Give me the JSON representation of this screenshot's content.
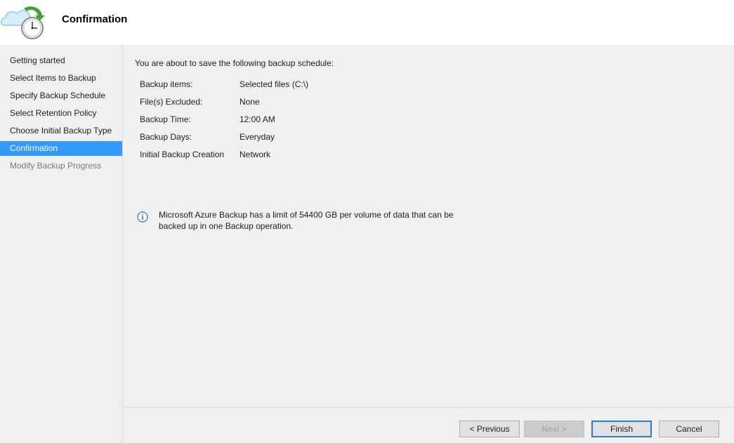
{
  "header": {
    "title": "Confirmation",
    "icon": "backup-schedule-icon"
  },
  "sidebar": {
    "items": [
      {
        "label": "Getting started",
        "state": "normal"
      },
      {
        "label": "Select Items to Backup",
        "state": "normal"
      },
      {
        "label": "Specify Backup Schedule",
        "state": "normal"
      },
      {
        "label": "Select Retention Policy",
        "state": "normal"
      },
      {
        "label": "Choose Initial Backup Type",
        "state": "normal"
      },
      {
        "label": "Confirmation",
        "state": "active"
      },
      {
        "label": "Modify Backup Progress",
        "state": "disabled"
      }
    ]
  },
  "main": {
    "intro": "You are about to save the following backup schedule:",
    "summary": [
      {
        "label": "Backup items:",
        "value": "Selected files (C:\\)"
      },
      {
        "label": "File(s) Excluded:",
        "value": "None"
      },
      {
        "label": "Backup Time:",
        "value": "12:00 AM"
      },
      {
        "label": "Backup Days:",
        "value": "Everyday"
      },
      {
        "label": "Initial Backup Creation",
        "value": "Network"
      }
    ],
    "info_line1": "Microsoft Azure Backup has a limit of 54400 GB per volume of data that can be",
    "info_line2": "backed up in one Backup operation."
  },
  "footer": {
    "previous": "< Previous",
    "next": "Next >",
    "finish": "Finish",
    "cancel": "Cancel"
  },
  "colors": {
    "accent": "#3399ff",
    "background": "#f0f0f0",
    "header_bg": "#ffffff",
    "default_button_border": "#2b7bd8"
  }
}
